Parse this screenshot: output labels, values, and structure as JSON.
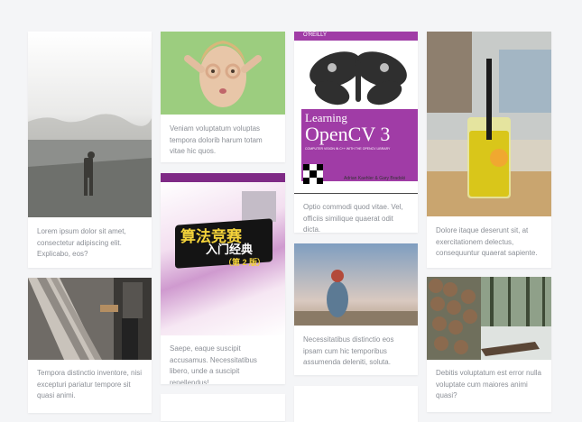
{
  "cards": [
    {
      "caption": "Lorem ipsum dolor sit amet, consectetur adipiscing elit. Explicabo, eos?"
    },
    {
      "caption": "Tempora distinctio inventore, nisi excepturi pariatur tempore sit quasi animi."
    },
    {
      "caption": "Veniam voluptatum voluptas tempora dolorib harum totam vitae hic quos."
    },
    {
      "caption": "Saepe, eaque suscipit accusamus. Necessitatibus libero, unde a suscipit repellendus!"
    },
    {
      "caption": "Optio commodi quod vitae. Vel, officiis similique quaerat odit dicta."
    },
    {
      "caption": "Necessitatibus distinctio eos ipsam cum hic temporibus assumenda deleniti, soluta."
    },
    {
      "caption": "Dolore itaque deserunt sit, at exercitationem delectus, consequuntur quaerat sapiente."
    },
    {
      "caption": "Debitis voluptatum est error nulla voluptate cum maiores animi quasi?"
    }
  ],
  "book_opencv": {
    "publisher": "O'REILLY",
    "title_line1": "Learning",
    "title_line2": "OpenCV 3",
    "subtitle": "COMPUTER VISION IN C++ WITH THE OPENCV LIBRARY",
    "authors": "Adrian Kaehler & Gary Bradski"
  },
  "book_algo": {
    "title_line1": "算法竞赛",
    "title_line2": "入门经典",
    "edition": "（第 2 版）"
  }
}
